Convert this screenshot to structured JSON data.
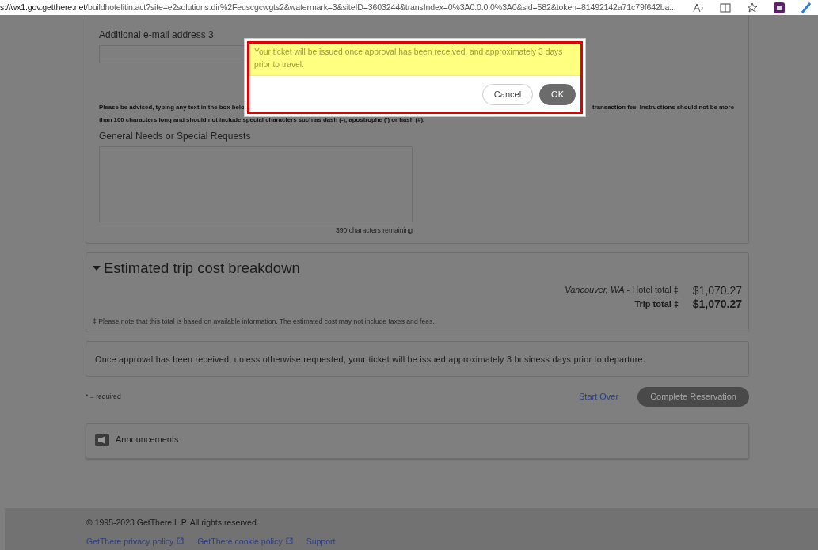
{
  "browser": {
    "url_host": "s://wx1.gov.getthere.net",
    "url_rest": "/buildhotelitin.act?site=e2solutions.dir%2Feuscgcwgts2&watermark=3&siteID=3603244&transIndex=0%3A0.0.0.0%3A0&sid=582&token=81492142a71c79f642ba..."
  },
  "form": {
    "email_label": "Additional e-mail address 3",
    "advisory": [
      "Please be advised, typing any text in the box belo",
      "transaction fee. Instructions should not be more",
      "than 100 characters long and should not include special characters such as dash (-), apostrophe (') or hash (#)."
    ],
    "requests_label": "General Needs or Special Requests",
    "remaining": "390 characters remaining"
  },
  "cost": {
    "title": "Estimated trip cost breakdown",
    "expanded": true,
    "lines": [
      {
        "kind": "item",
        "place": "Vancouver, WA",
        "label": " - Hotel total ‡",
        "amount": "$1,070.27"
      },
      {
        "kind": "total",
        "label": "Trip total ‡",
        "amount": "$1,070.27"
      }
    ],
    "note": "‡ Please note that this total is based on available information. The estimated cost may not include taxes and fees."
  },
  "approval_note": "Once approval has been received, unless otherwise requested, your ticket will be issued approximately 3 business days prior to departure.",
  "actions": {
    "required": "* = required",
    "start_over": "Start Over",
    "complete": "Complete Reservation"
  },
  "announcements": "Announcements",
  "footer": {
    "copyright": "© 1995-2023 GetThere L.P. All rights reserved.",
    "links": [
      {
        "label": "GetThere privacy policy",
        "external": true
      },
      {
        "label": "GetThere cookie policy",
        "external": true
      },
      {
        "label": "Support",
        "external": false
      }
    ]
  },
  "dialog": {
    "message": "Your ticket will be issued once approval has been received, and approximately 3 days prior to travel.",
    "buttons": [
      {
        "label": "Cancel",
        "kind": "secondary"
      },
      {
        "label": "OK",
        "kind": "primary"
      }
    ]
  }
}
